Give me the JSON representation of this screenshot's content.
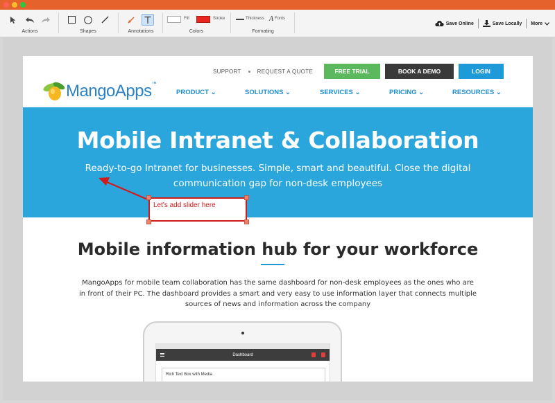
{
  "toolbar": {
    "groups": {
      "actions": "Actions",
      "shapes": "Shapes",
      "annotations": "Annotations",
      "colors": "Colors",
      "formatting": "Formating"
    },
    "fill_label": "Fill",
    "stroke_label": "Stroke",
    "thickness_label": "Thickness",
    "fonts_label": "Fonts",
    "fill_color": "#ffffff",
    "stroke_color": "#e8251f",
    "save_online": "Save Online",
    "save_locally": "Save Locally",
    "more": "More"
  },
  "site": {
    "top_links": {
      "support": "SUPPORT",
      "request_quote": "REQUEST A QUOTE"
    },
    "buttons": {
      "trial": "FREE TRIAL",
      "demo": "BOOK A DEMO",
      "login": "LOGIN"
    },
    "logo": {
      "name": "MangoApps",
      "tm": "™"
    },
    "nav": [
      "PRODUCT ⌄",
      "SOLUTIONS ⌄",
      "SERVICES ⌄",
      "PRICING ⌄",
      "RESOURCES ⌄"
    ],
    "hero": {
      "title": "Mobile Intranet & Collaboration",
      "subtitle": "Ready-to-go Intranet for businesses. Simple, smart and beautiful. Close the digital communication gap for non-desk employees"
    },
    "section_title": "Mobile information hub for your workforce",
    "section_body": "MangoApps for mobile team collaboration has the same dashboard for non-desk employees as the ones who are in front of their PC. The dashboard provides a smart and very easy to use information layer that connects multiple sources of news and information across the company",
    "tablet": {
      "app_title": "Dashboard",
      "card_title": "Rich Text Box with Media"
    }
  },
  "annotation": {
    "text": "Let's add slider here",
    "color": "#d31a1a"
  }
}
